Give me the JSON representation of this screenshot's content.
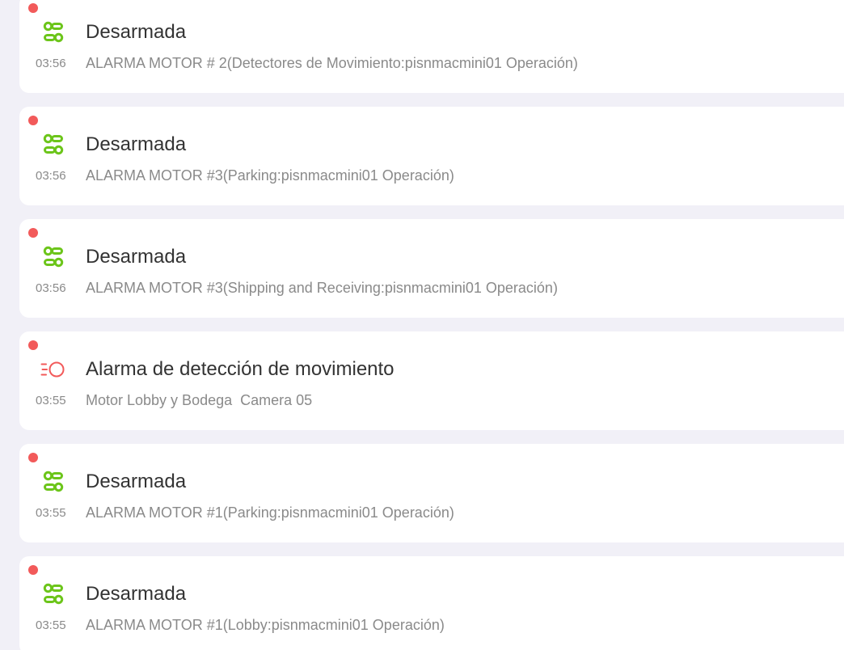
{
  "colors": {
    "background": "#f1f0f7",
    "card": "#ffffff",
    "unread_dot": "#f25a5a",
    "disarmed_icon": "#6cc51a",
    "motion_icon": "#f25a5a",
    "title_text": "#333333",
    "secondary_text": "#8a8a8a"
  },
  "events": [
    {
      "icon": "disarm-icon",
      "unread": true,
      "title": "Desarmada",
      "time": "03:56",
      "description": "ALARMA MOTOR # 2(Detectores de Movimiento:pisnmacmini01 Operación)"
    },
    {
      "icon": "disarm-icon",
      "unread": true,
      "title": "Desarmada",
      "time": "03:56",
      "description": "ALARMA MOTOR #3(Parking:pisnmacmini01 Operación)"
    },
    {
      "icon": "disarm-icon",
      "unread": true,
      "title": "Desarmada",
      "time": "03:56",
      "description": "ALARMA MOTOR #3(Shipping and Receiving:pisnmacmini01 Operación)"
    },
    {
      "icon": "motion-detection-icon",
      "unread": true,
      "title": "Alarma de detección de movimiento",
      "time": "03:55",
      "description": "Motor Lobby y Bodega  Camera 05"
    },
    {
      "icon": "disarm-icon",
      "unread": true,
      "title": "Desarmada",
      "time": "03:55",
      "description": "ALARMA MOTOR #1(Parking:pisnmacmini01 Operación)"
    },
    {
      "icon": "disarm-icon",
      "unread": true,
      "title": "Desarmada",
      "time": "03:55",
      "description": "ALARMA MOTOR #1(Lobby:pisnmacmini01 Operación)"
    }
  ]
}
